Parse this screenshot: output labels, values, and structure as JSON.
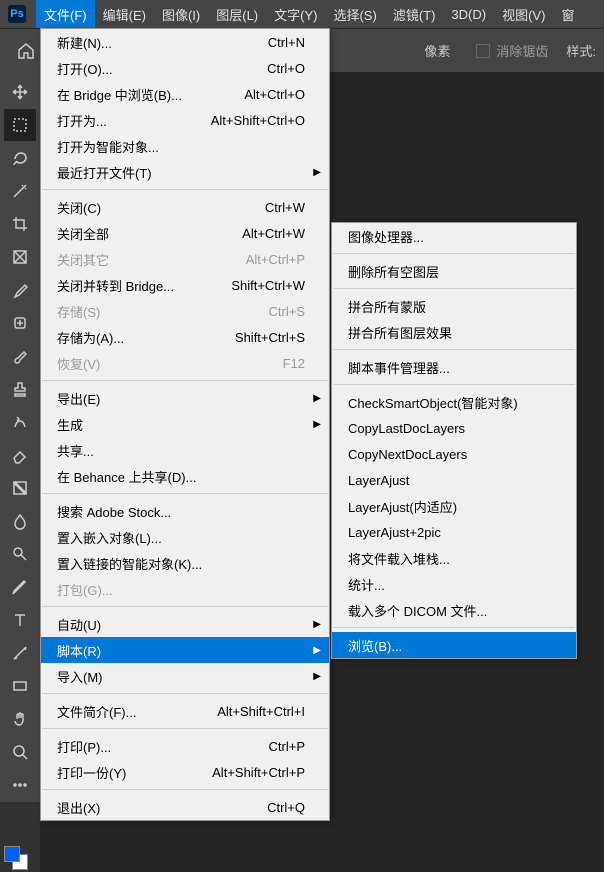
{
  "logo": "Ps",
  "menubar": [
    "文件(F)",
    "编辑(E)",
    "图像(I)",
    "图层(L)",
    "文字(Y)",
    "选择(S)",
    "滤镜(T)",
    "3D(D)",
    "视图(V)",
    "窗"
  ],
  "topbar": {
    "px_label": "像素",
    "antialias": "消除锯齿",
    "style": "样式:"
  },
  "menu1": [
    {
      "t": "item",
      "label": "新建(N)...",
      "shortcut": "Ctrl+N"
    },
    {
      "t": "item",
      "label": "打开(O)...",
      "shortcut": "Ctrl+O"
    },
    {
      "t": "item",
      "label": "在 Bridge 中浏览(B)...",
      "shortcut": "Alt+Ctrl+O"
    },
    {
      "t": "item",
      "label": "打开为...",
      "shortcut": "Alt+Shift+Ctrl+O"
    },
    {
      "t": "item",
      "label": "打开为智能对象..."
    },
    {
      "t": "sub",
      "label": "最近打开文件(T)"
    },
    {
      "t": "sep"
    },
    {
      "t": "item",
      "label": "关闭(C)",
      "shortcut": "Ctrl+W"
    },
    {
      "t": "item",
      "label": "关闭全部",
      "shortcut": "Alt+Ctrl+W"
    },
    {
      "t": "item",
      "label": "关闭其它",
      "shortcut": "Alt+Ctrl+P",
      "disabled": true
    },
    {
      "t": "item",
      "label": "关闭并转到 Bridge...",
      "shortcut": "Shift+Ctrl+W"
    },
    {
      "t": "item",
      "label": "存储(S)",
      "shortcut": "Ctrl+S",
      "disabled": true
    },
    {
      "t": "item",
      "label": "存储为(A)...",
      "shortcut": "Shift+Ctrl+S"
    },
    {
      "t": "item",
      "label": "恢复(V)",
      "shortcut": "F12",
      "disabled": true
    },
    {
      "t": "sep"
    },
    {
      "t": "sub",
      "label": "导出(E)"
    },
    {
      "t": "sub",
      "label": "生成"
    },
    {
      "t": "item",
      "label": "共享..."
    },
    {
      "t": "item",
      "label": "在 Behance 上共享(D)..."
    },
    {
      "t": "sep"
    },
    {
      "t": "item",
      "label": "搜索 Adobe Stock..."
    },
    {
      "t": "item",
      "label": "置入嵌入对象(L)..."
    },
    {
      "t": "item",
      "label": "置入链接的智能对象(K)..."
    },
    {
      "t": "item",
      "label": "打包(G)...",
      "disabled": true
    },
    {
      "t": "sep"
    },
    {
      "t": "sub",
      "label": "自动(U)"
    },
    {
      "t": "sub",
      "label": "脚本(R)",
      "hl": true
    },
    {
      "t": "sub",
      "label": "导入(M)"
    },
    {
      "t": "sep"
    },
    {
      "t": "item",
      "label": "文件简介(F)...",
      "shortcut": "Alt+Shift+Ctrl+I"
    },
    {
      "t": "sep"
    },
    {
      "t": "item",
      "label": "打印(P)...",
      "shortcut": "Ctrl+P"
    },
    {
      "t": "item",
      "label": "打印一份(Y)",
      "shortcut": "Alt+Shift+Ctrl+P"
    },
    {
      "t": "sep"
    },
    {
      "t": "item",
      "label": "退出(X)",
      "shortcut": "Ctrl+Q"
    }
  ],
  "menu2": [
    {
      "t": "item",
      "label": "图像处理器..."
    },
    {
      "t": "sep"
    },
    {
      "t": "item",
      "label": "删除所有空图层"
    },
    {
      "t": "sep"
    },
    {
      "t": "item",
      "label": "拼合所有蒙版"
    },
    {
      "t": "item",
      "label": "拼合所有图层效果"
    },
    {
      "t": "sep"
    },
    {
      "t": "item",
      "label": "脚本事件管理器..."
    },
    {
      "t": "sep"
    },
    {
      "t": "item",
      "label": "CheckSmartObject(智能对象)"
    },
    {
      "t": "item",
      "label": "CopyLastDocLayers"
    },
    {
      "t": "item",
      "label": "CopyNextDocLayers"
    },
    {
      "t": "item",
      "label": "LayerAjust"
    },
    {
      "t": "item",
      "label": "LayerAjust(内适应)"
    },
    {
      "t": "item",
      "label": "LayerAjust+2pic"
    },
    {
      "t": "item",
      "label": "将文件载入堆栈..."
    },
    {
      "t": "item",
      "label": "统计..."
    },
    {
      "t": "item",
      "label": "载入多个 DICOM 文件..."
    },
    {
      "t": "sep"
    },
    {
      "t": "item",
      "label": "浏览(B)...",
      "hl": true
    }
  ],
  "tools": [
    "move",
    "marquee",
    "lasso",
    "wand",
    "crop",
    "frame",
    "eyedrop",
    "heal",
    "brush",
    "stamp",
    "history",
    "eraser",
    "gradient",
    "blur",
    "dodge",
    "pen",
    "type",
    "path",
    "rect",
    "hand",
    "zoom",
    "more"
  ]
}
